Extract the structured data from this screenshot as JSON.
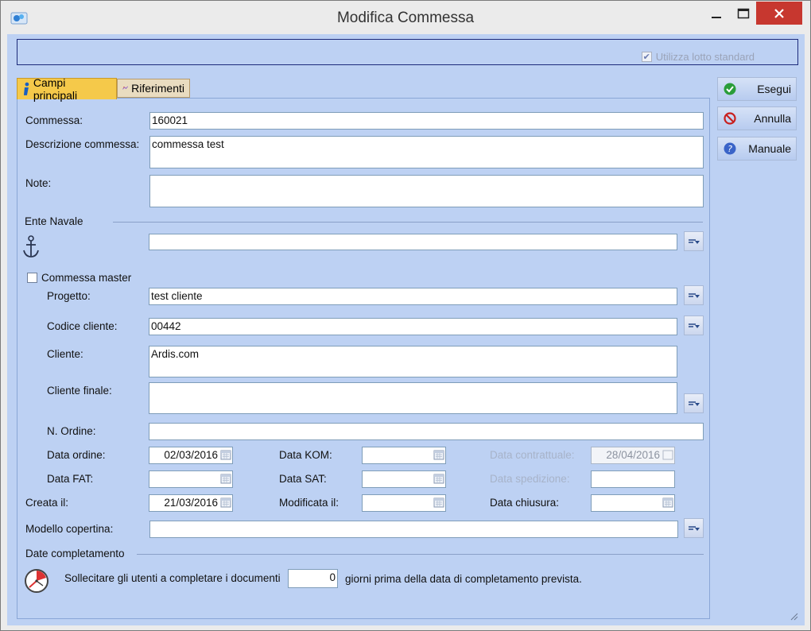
{
  "window": {
    "title": "Modifica Commessa",
    "lotto_label": "Utilizza lotto standard",
    "lotto_checked": true
  },
  "tabs": [
    {
      "label": "Campi principali",
      "active": true
    },
    {
      "label": "Riferimenti",
      "active": false
    }
  ],
  "buttons": {
    "esegui": "Esegui",
    "annulla": "Annulla",
    "manuale": "Manuale"
  },
  "form": {
    "commessa": {
      "label": "Commessa:",
      "value": "160021"
    },
    "descrizione": {
      "label": "Descrizione commessa:",
      "value": "commessa test"
    },
    "note": {
      "label": "Note:",
      "value": ""
    },
    "ente_navale": {
      "label": "Ente Navale",
      "value": ""
    },
    "commessa_master": {
      "label": "Commessa master",
      "checked": false
    },
    "progetto": {
      "label": "Progetto:",
      "value": "test cliente"
    },
    "codice_cliente": {
      "label": "Codice cliente:",
      "value": "00442"
    },
    "cliente": {
      "label": "Cliente:",
      "value": "Ardis.com"
    },
    "cliente_finale": {
      "label": "Cliente finale:",
      "value": ""
    },
    "n_ordine": {
      "label": "N. Ordine:",
      "value": ""
    },
    "data_ordine": {
      "label": "Data ordine:",
      "value": "02/03/2016"
    },
    "data_kom": {
      "label": "Data KOM:",
      "value": ""
    },
    "data_contrattuale": {
      "label": "Data contrattuale:",
      "value": "28/04/2016"
    },
    "data_fat": {
      "label": "Data FAT:",
      "value": ""
    },
    "data_sat": {
      "label": "Data SAT:",
      "value": ""
    },
    "data_spedizione": {
      "label": "Data spedizione:",
      "value": ""
    },
    "creata_il": {
      "label": "Creata il:",
      "value": "21/03/2016"
    },
    "modificata_il": {
      "label": "Modificata il:",
      "value": ""
    },
    "data_chiusura": {
      "label": "Data chiusura:",
      "value": ""
    },
    "modello_copertina": {
      "label": "Modello copertina:",
      "value": ""
    },
    "date_completamento": {
      "label": "Date completamento"
    },
    "sollecitare": {
      "prefix": "Sollecitare gli utenti a completare i documenti",
      "value": "0",
      "suffix": "giorni prima della data di completamento prevista."
    }
  },
  "colors": {
    "panel_bg": "#bdd1f3",
    "active_tab": "#f5c94a",
    "close_button": "#c7372f"
  }
}
